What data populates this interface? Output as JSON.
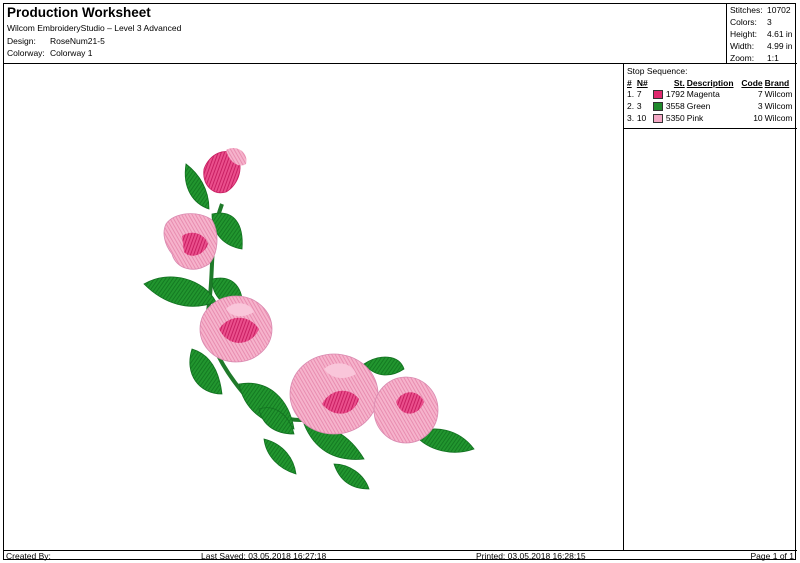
{
  "header": {
    "title": "Production Worksheet",
    "software": "Wilcom EmbroideryStudio – Level 3 Advanced",
    "design_label": "Design:",
    "design_value": "RoseNum21-5",
    "colorway_label": "Colorway:",
    "colorway_value": "Colorway 1"
  },
  "stats": {
    "stitches_label": "Stitches:",
    "stitches": "10702",
    "colors_label": "Colors:",
    "colors": "3",
    "height_label": "Height:",
    "height": "4.61 in",
    "width_label": "Width:",
    "width": "4.99 in",
    "zoom_label": "Zoom:",
    "zoom": "1:1"
  },
  "stop_sequence": {
    "title": "Stop Sequence:",
    "headers": [
      "#",
      "N#",
      "St.",
      "Description",
      "Code",
      "Brand"
    ],
    "rows": [
      {
        "num": "1.",
        "needle": "7",
        "stitch": "1792",
        "description": "Magenta",
        "code": "7",
        "brand": "Wilcom",
        "color": "#e0286e"
      },
      {
        "num": "2.",
        "needle": "3",
        "stitch": "3558",
        "description": "Green",
        "code": "3",
        "brand": "Wilcom",
        "color": "#1f8a2c"
      },
      {
        "num": "3.",
        "needle": "10",
        "stitch": "5350",
        "description": "Pink",
        "code": "10",
        "brand": "Wilcom",
        "color": "#f3a7c4"
      }
    ]
  },
  "footer": {
    "created_by": "Created By:",
    "last_saved": "Last Saved: 03.05.2018 16:27:18",
    "printed": "Printed: 03.05.2018 16:28:15",
    "page": "Page 1 of 1"
  },
  "colors": {
    "magenta": "#e0286e",
    "green": "#1f8a2c",
    "pink": "#f3a7c4"
  },
  "design_image": {
    "subject": "embroidered corner spray of pink roses with green leaves",
    "icon": "rose-embroidery"
  }
}
